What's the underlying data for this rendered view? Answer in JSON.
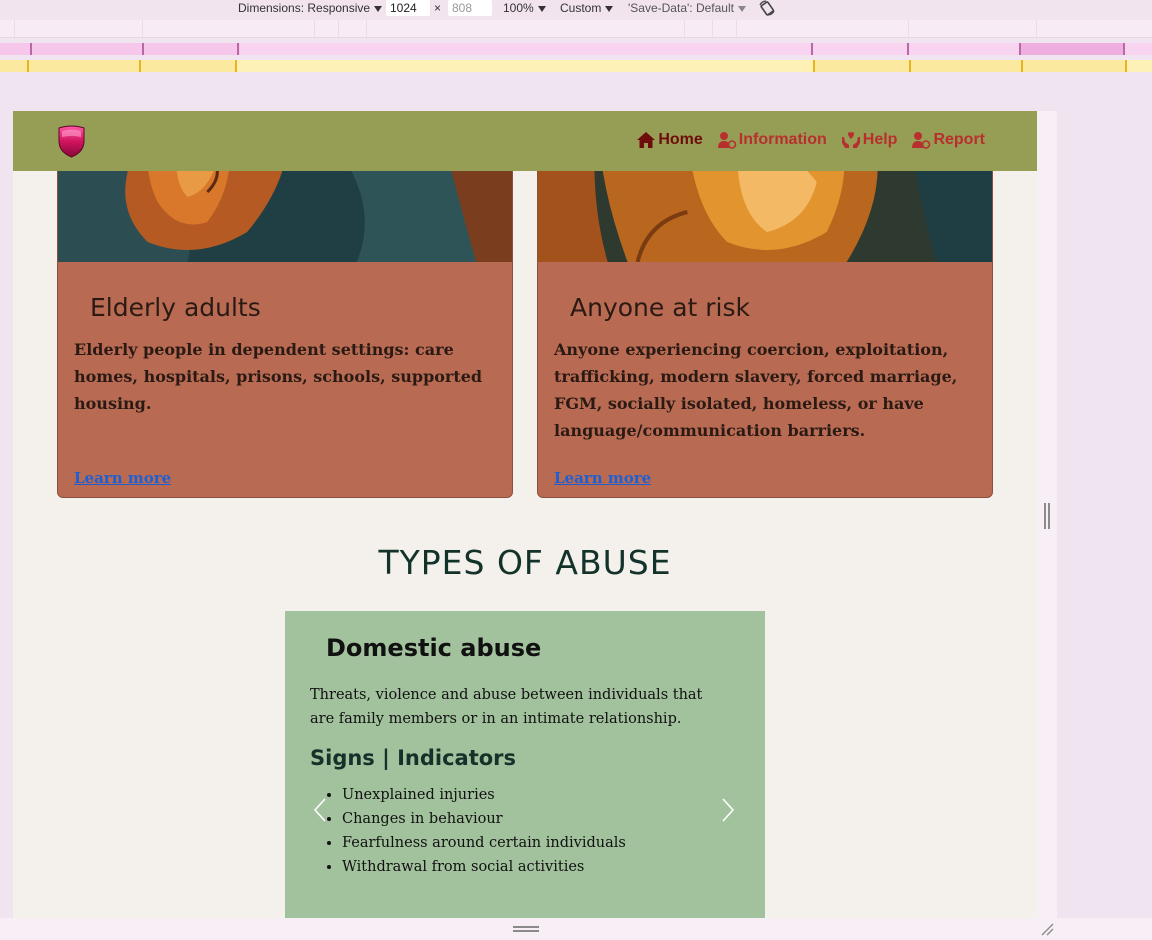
{
  "devtools": {
    "dimensions_label": "Dimensions: Responsive",
    "width_value": "1024",
    "times": "×",
    "height_placeholder": "808",
    "zoom": "100%",
    "throttle": "Custom",
    "save_data": "'Save-Data': Default"
  },
  "nav": {
    "items": [
      {
        "label": "Home",
        "icon": "home-icon"
      },
      {
        "label": "Information",
        "icon": "person-info-icon"
      },
      {
        "label": "Help",
        "icon": "hands-heart-icon"
      },
      {
        "label": "Report",
        "icon": "person-report-icon"
      }
    ]
  },
  "cards": [
    {
      "title": "Elderly adults",
      "text": "Elderly people in dependent settings: care homes, hospitals, prisons, schools, supported housing.",
      "link": "Learn more"
    },
    {
      "title": "Anyone at risk",
      "text": "Anyone experiencing coercion, exploitation, trafficking, modern slavery, forced marriage, FGM, socially isolated, homeless, or have language/communication barriers.",
      "link": "Learn more"
    }
  ],
  "section": {
    "title": "TYPES OF ABUSE"
  },
  "carousel": {
    "title": "Domestic abuse",
    "description": "Threats, violence and abuse between individuals that are family members or in an intimate relationship.",
    "subtitle": "Signs | Indicators",
    "items": [
      "Unexplained injuries",
      "Changes in behaviour",
      "Fearfulness around certain individuals",
      "Withdrawal from social activities"
    ]
  },
  "colors": {
    "header": "#969e56",
    "card": "#b86b52",
    "carousel": "#a2c19d",
    "nav_link": "#b8302e",
    "nav_active": "#6e0d0b"
  }
}
